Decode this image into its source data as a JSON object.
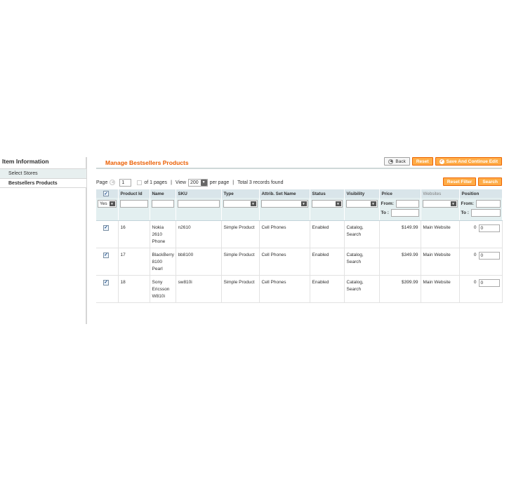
{
  "sidebar": {
    "title": "Item Information",
    "items": [
      {
        "label": "Select Stores",
        "active": false
      },
      {
        "label": "Bestsellers Products",
        "active": true
      }
    ]
  },
  "header": {
    "title": "Manage Bestsellers Products",
    "back_label": "Back",
    "reset_label": "Reset",
    "save_continue_label": "Save And Continue Edit"
  },
  "pager": {
    "page_label": "Page",
    "page_value": "1",
    "of_pages": "of 1 pages",
    "view_label": "View",
    "per_page_value": "200",
    "per_page_label": "per page",
    "total": "Total 3 records found",
    "reset_filter_label": "Reset Filter",
    "search_label": "Search"
  },
  "columns": {
    "product_id": "Product Id",
    "name": "Name",
    "sku": "SKU",
    "type": "Type",
    "attrib_set": "Attrib. Set Name",
    "status": "Status",
    "visibility": "Visibility",
    "price": "Price",
    "websites": "Websites",
    "position": "Position"
  },
  "filters": {
    "select_value": "Yes",
    "from_label": "From:",
    "to_label": "To :"
  },
  "rows": [
    {
      "id": "16",
      "name": "Nokia 2610 Phone",
      "sku": "n2610",
      "type": "Simple Product",
      "attrib": "Cell Phones",
      "status": "Enabled",
      "visibility": "Catalog, Search",
      "price": "$149.99",
      "website": "Main Website",
      "pos_text": "0",
      "pos_input": "0"
    },
    {
      "id": "17",
      "name": "BlackBerry 8100 Pearl",
      "sku": "bb8100",
      "type": "Simple Product",
      "attrib": "Cell Phones",
      "status": "Enabled",
      "visibility": "Catalog, Search",
      "price": "$349.99",
      "website": "Main Website",
      "pos_text": "0",
      "pos_input": "0"
    },
    {
      "id": "18",
      "name": "Sony Ericsson W810i",
      "sku": "sw810i",
      "type": "Simple Product",
      "attrib": "Cell Phones",
      "status": "Enabled",
      "visibility": "Catalog, Search",
      "price": "$399.99",
      "website": "Main Website",
      "pos_text": "0",
      "pos_input": "0"
    }
  ],
  "colors": {
    "accent": "#eb5e00",
    "button": "#ffac47",
    "header_bg": "#d9e5ea"
  },
  "icons": {
    "check": "check-icon",
    "back": "back-arrow-icon",
    "save": "save-continue-icon",
    "dropdown": "dropdown-arrow-icon"
  }
}
